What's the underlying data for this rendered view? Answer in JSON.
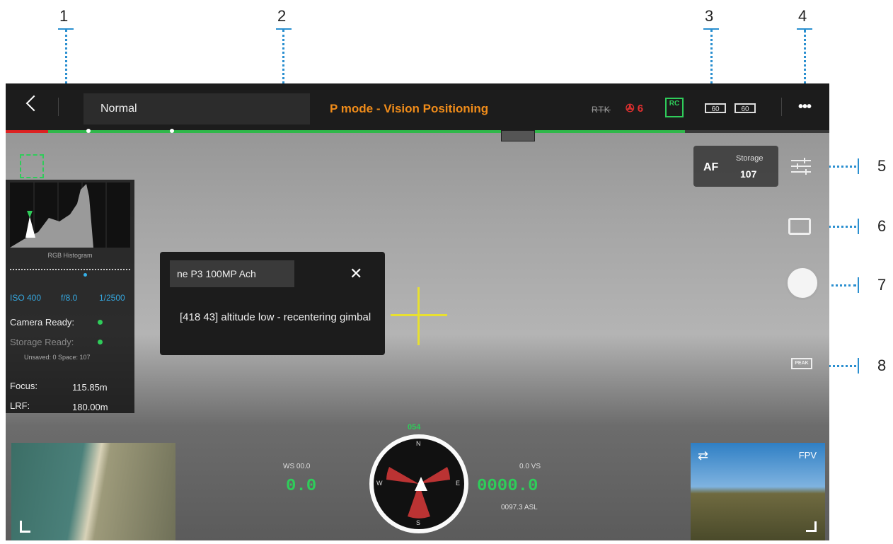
{
  "callouts": [
    "1",
    "2",
    "3",
    "4",
    "5",
    "6",
    "7",
    "8"
  ],
  "topbar": {
    "mode_box": "Normal",
    "flight_mode": "P mode - Vision Positioning",
    "rtk_label": "RTK",
    "satellite_count": "6",
    "rc_label": "RC",
    "battery_left": "60",
    "battery_right": "60",
    "more_label": "•••"
  },
  "histogram": {
    "label": "RGB Histogram",
    "iso": "ISO 400",
    "aperture": "f/8.0",
    "shutter": "1/2500",
    "camera_ready": "Camera Ready:",
    "storage_ready": "Storage Ready:",
    "unsaved": "Unsaved: 0   Space: 107",
    "focus_label": "Focus:",
    "focus_value": "115.85m",
    "lrf_label": "LRF:",
    "lrf_value": "180.00m"
  },
  "message": {
    "camera_name": "ne P3 100MP Ach",
    "close_label": "✕",
    "text": "[418 43] altitude low - recentering gimbal"
  },
  "camera": {
    "af_label": "AF",
    "storage_label": "Storage",
    "storage_value": "107",
    "peak_label": "PEAK"
  },
  "fpv": {
    "label": "FPV",
    "swap_label": "⇄"
  },
  "telemetry": {
    "heading": "054",
    "ws": "WS 00.0",
    "vs": "0.0  VS",
    "speed_big": "0.0",
    "alt_big": "0000.0",
    "asl": "0097.3 ASL",
    "compass_n": "N",
    "compass_e": "E",
    "compass_s": "S",
    "compass_w": "W"
  }
}
